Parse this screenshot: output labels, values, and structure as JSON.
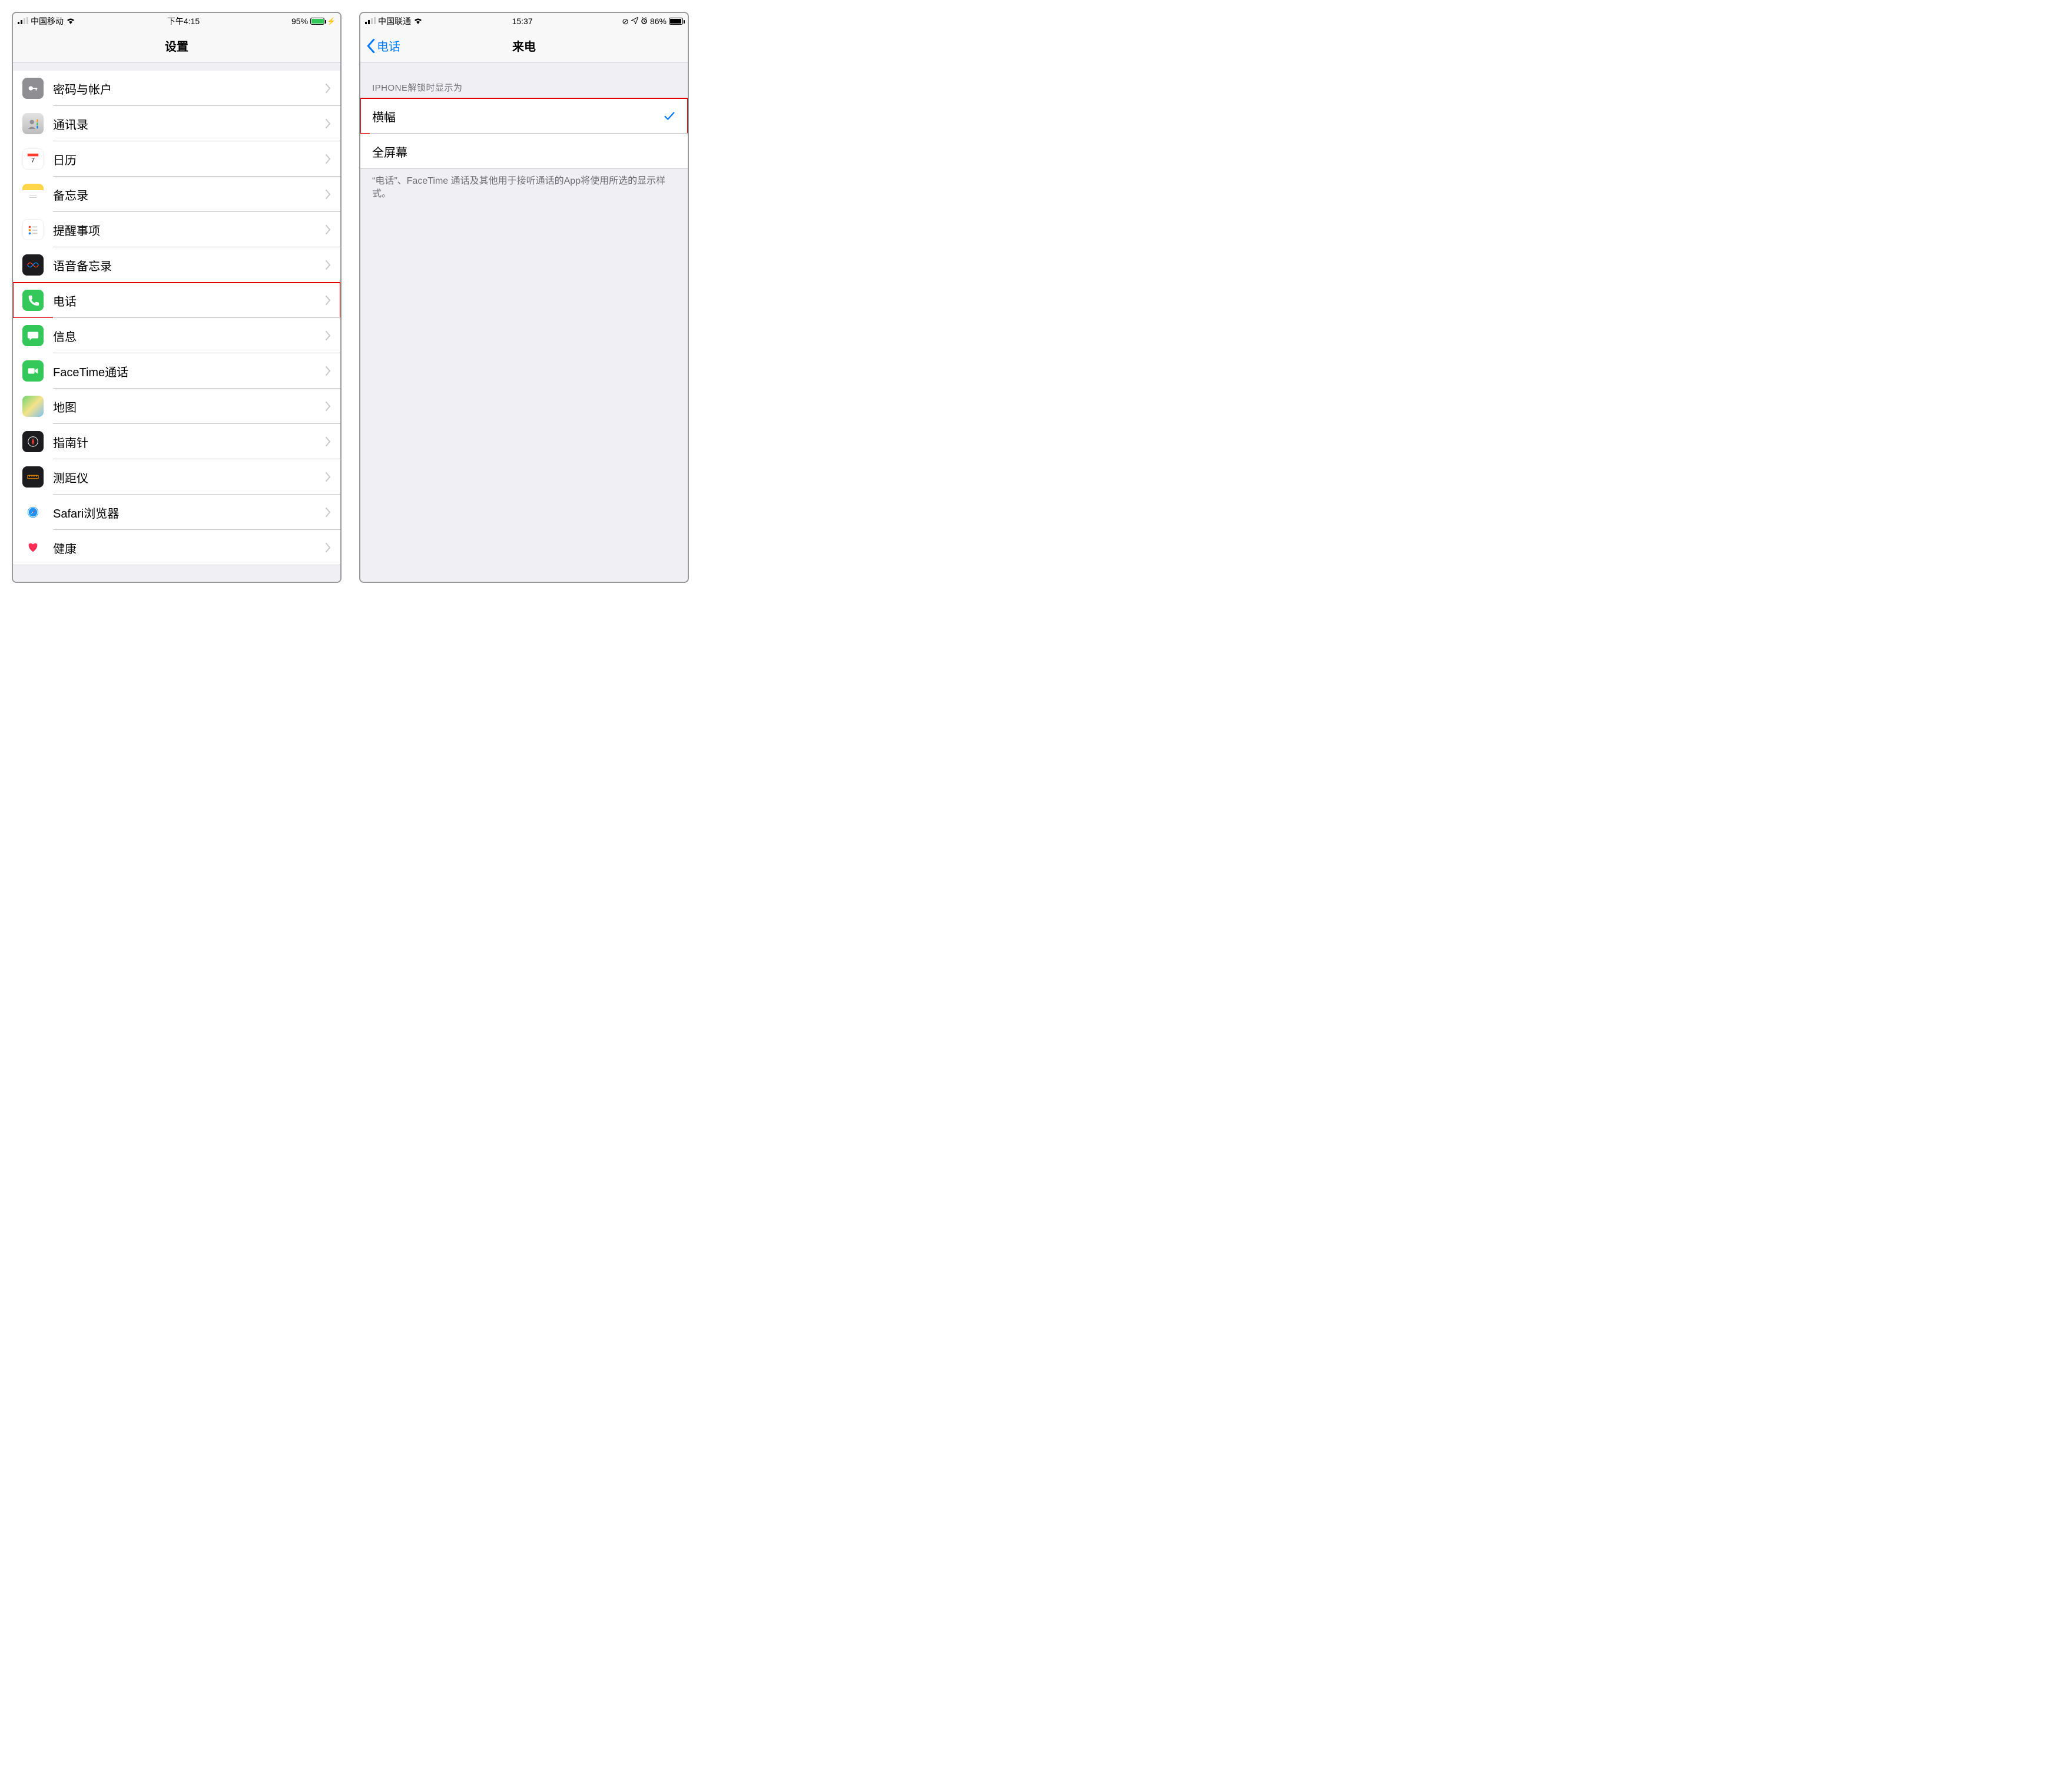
{
  "left": {
    "status": {
      "carrier": "中国移动",
      "time": "下午4:15",
      "battery_pct": "95%",
      "battery_level": 0.95,
      "charging": true
    },
    "nav": {
      "title": "设置"
    },
    "cells": [
      {
        "id": "passwords",
        "label": "密码与帐户",
        "highlight": false
      },
      {
        "id": "contacts",
        "label": "通讯录",
        "highlight": false
      },
      {
        "id": "calendar",
        "label": "日历",
        "highlight": false
      },
      {
        "id": "notes",
        "label": "备忘录",
        "highlight": false
      },
      {
        "id": "reminders",
        "label": "提醒事项",
        "highlight": false
      },
      {
        "id": "voicememos",
        "label": "语音备忘录",
        "highlight": false
      },
      {
        "id": "phone",
        "label": "电话",
        "highlight": true
      },
      {
        "id": "messages",
        "label": "信息",
        "highlight": false
      },
      {
        "id": "facetime",
        "label": "FaceTime通话",
        "highlight": false
      },
      {
        "id": "maps",
        "label": "地图",
        "highlight": false
      },
      {
        "id": "compass",
        "label": "指南针",
        "highlight": false
      },
      {
        "id": "measure",
        "label": "测距仪",
        "highlight": false
      },
      {
        "id": "safari",
        "label": "Safari浏览器",
        "highlight": false
      },
      {
        "id": "health",
        "label": "健康",
        "highlight": false
      }
    ]
  },
  "right": {
    "status": {
      "carrier": "中国联通",
      "time": "15:37",
      "battery_pct": "86%",
      "battery_level": 0.86,
      "charging": false,
      "icons": [
        "rotation-lock",
        "location",
        "alarm"
      ]
    },
    "nav": {
      "back": "电话",
      "title": "来电"
    },
    "group_header": "IPHONE解锁时显示为",
    "options": [
      {
        "id": "banner",
        "label": "横幅",
        "selected": true,
        "highlight": true
      },
      {
        "id": "fullscreen",
        "label": "全屏幕",
        "selected": false,
        "highlight": false
      }
    ],
    "footer": "“电话”、FaceTime 通话及其他用于接听通话的App将使用所选的显示样式。"
  }
}
